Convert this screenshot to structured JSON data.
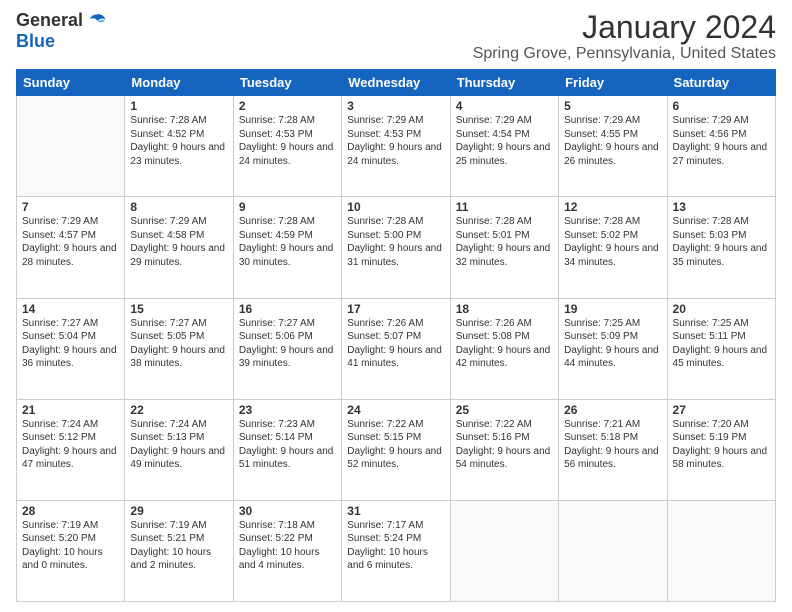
{
  "logo": {
    "text_general": "General",
    "text_blue": "Blue"
  },
  "header": {
    "month": "January 2024",
    "location": "Spring Grove, Pennsylvania, United States"
  },
  "days_of_week": [
    "Sunday",
    "Monday",
    "Tuesday",
    "Wednesday",
    "Thursday",
    "Friday",
    "Saturday"
  ],
  "weeks": [
    [
      {
        "day": "",
        "sunrise": "",
        "sunset": "",
        "daylight": "",
        "empty": true
      },
      {
        "day": "1",
        "sunrise": "Sunrise: 7:28 AM",
        "sunset": "Sunset: 4:52 PM",
        "daylight": "Daylight: 9 hours and 23 minutes."
      },
      {
        "day": "2",
        "sunrise": "Sunrise: 7:28 AM",
        "sunset": "Sunset: 4:53 PM",
        "daylight": "Daylight: 9 hours and 24 minutes."
      },
      {
        "day": "3",
        "sunrise": "Sunrise: 7:29 AM",
        "sunset": "Sunset: 4:53 PM",
        "daylight": "Daylight: 9 hours and 24 minutes."
      },
      {
        "day": "4",
        "sunrise": "Sunrise: 7:29 AM",
        "sunset": "Sunset: 4:54 PM",
        "daylight": "Daylight: 9 hours and 25 minutes."
      },
      {
        "day": "5",
        "sunrise": "Sunrise: 7:29 AM",
        "sunset": "Sunset: 4:55 PM",
        "daylight": "Daylight: 9 hours and 26 minutes."
      },
      {
        "day": "6",
        "sunrise": "Sunrise: 7:29 AM",
        "sunset": "Sunset: 4:56 PM",
        "daylight": "Daylight: 9 hours and 27 minutes."
      }
    ],
    [
      {
        "day": "7",
        "sunrise": "Sunrise: 7:29 AM",
        "sunset": "Sunset: 4:57 PM",
        "daylight": "Daylight: 9 hours and 28 minutes."
      },
      {
        "day": "8",
        "sunrise": "Sunrise: 7:29 AM",
        "sunset": "Sunset: 4:58 PM",
        "daylight": "Daylight: 9 hours and 29 minutes."
      },
      {
        "day": "9",
        "sunrise": "Sunrise: 7:28 AM",
        "sunset": "Sunset: 4:59 PM",
        "daylight": "Daylight: 9 hours and 30 minutes."
      },
      {
        "day": "10",
        "sunrise": "Sunrise: 7:28 AM",
        "sunset": "Sunset: 5:00 PM",
        "daylight": "Daylight: 9 hours and 31 minutes."
      },
      {
        "day": "11",
        "sunrise": "Sunrise: 7:28 AM",
        "sunset": "Sunset: 5:01 PM",
        "daylight": "Daylight: 9 hours and 32 minutes."
      },
      {
        "day": "12",
        "sunrise": "Sunrise: 7:28 AM",
        "sunset": "Sunset: 5:02 PM",
        "daylight": "Daylight: 9 hours and 34 minutes."
      },
      {
        "day": "13",
        "sunrise": "Sunrise: 7:28 AM",
        "sunset": "Sunset: 5:03 PM",
        "daylight": "Daylight: 9 hours and 35 minutes."
      }
    ],
    [
      {
        "day": "14",
        "sunrise": "Sunrise: 7:27 AM",
        "sunset": "Sunset: 5:04 PM",
        "daylight": "Daylight: 9 hours and 36 minutes."
      },
      {
        "day": "15",
        "sunrise": "Sunrise: 7:27 AM",
        "sunset": "Sunset: 5:05 PM",
        "daylight": "Daylight: 9 hours and 38 minutes."
      },
      {
        "day": "16",
        "sunrise": "Sunrise: 7:27 AM",
        "sunset": "Sunset: 5:06 PM",
        "daylight": "Daylight: 9 hours and 39 minutes."
      },
      {
        "day": "17",
        "sunrise": "Sunrise: 7:26 AM",
        "sunset": "Sunset: 5:07 PM",
        "daylight": "Daylight: 9 hours and 41 minutes."
      },
      {
        "day": "18",
        "sunrise": "Sunrise: 7:26 AM",
        "sunset": "Sunset: 5:08 PM",
        "daylight": "Daylight: 9 hours and 42 minutes."
      },
      {
        "day": "19",
        "sunrise": "Sunrise: 7:25 AM",
        "sunset": "Sunset: 5:09 PM",
        "daylight": "Daylight: 9 hours and 44 minutes."
      },
      {
        "day": "20",
        "sunrise": "Sunrise: 7:25 AM",
        "sunset": "Sunset: 5:11 PM",
        "daylight": "Daylight: 9 hours and 45 minutes."
      }
    ],
    [
      {
        "day": "21",
        "sunrise": "Sunrise: 7:24 AM",
        "sunset": "Sunset: 5:12 PM",
        "daylight": "Daylight: 9 hours and 47 minutes."
      },
      {
        "day": "22",
        "sunrise": "Sunrise: 7:24 AM",
        "sunset": "Sunset: 5:13 PM",
        "daylight": "Daylight: 9 hours and 49 minutes."
      },
      {
        "day": "23",
        "sunrise": "Sunrise: 7:23 AM",
        "sunset": "Sunset: 5:14 PM",
        "daylight": "Daylight: 9 hours and 51 minutes."
      },
      {
        "day": "24",
        "sunrise": "Sunrise: 7:22 AM",
        "sunset": "Sunset: 5:15 PM",
        "daylight": "Daylight: 9 hours and 52 minutes."
      },
      {
        "day": "25",
        "sunrise": "Sunrise: 7:22 AM",
        "sunset": "Sunset: 5:16 PM",
        "daylight": "Daylight: 9 hours and 54 minutes."
      },
      {
        "day": "26",
        "sunrise": "Sunrise: 7:21 AM",
        "sunset": "Sunset: 5:18 PM",
        "daylight": "Daylight: 9 hours and 56 minutes."
      },
      {
        "day": "27",
        "sunrise": "Sunrise: 7:20 AM",
        "sunset": "Sunset: 5:19 PM",
        "daylight": "Daylight: 9 hours and 58 minutes."
      }
    ],
    [
      {
        "day": "28",
        "sunrise": "Sunrise: 7:19 AM",
        "sunset": "Sunset: 5:20 PM",
        "daylight": "Daylight: 10 hours and 0 minutes."
      },
      {
        "day": "29",
        "sunrise": "Sunrise: 7:19 AM",
        "sunset": "Sunset: 5:21 PM",
        "daylight": "Daylight: 10 hours and 2 minutes."
      },
      {
        "day": "30",
        "sunrise": "Sunrise: 7:18 AM",
        "sunset": "Sunset: 5:22 PM",
        "daylight": "Daylight: 10 hours and 4 minutes."
      },
      {
        "day": "31",
        "sunrise": "Sunrise: 7:17 AM",
        "sunset": "Sunset: 5:24 PM",
        "daylight": "Daylight: 10 hours and 6 minutes."
      },
      {
        "day": "",
        "sunrise": "",
        "sunset": "",
        "daylight": "",
        "empty": true
      },
      {
        "day": "",
        "sunrise": "",
        "sunset": "",
        "daylight": "",
        "empty": true
      },
      {
        "day": "",
        "sunrise": "",
        "sunset": "",
        "daylight": "",
        "empty": true
      }
    ]
  ]
}
